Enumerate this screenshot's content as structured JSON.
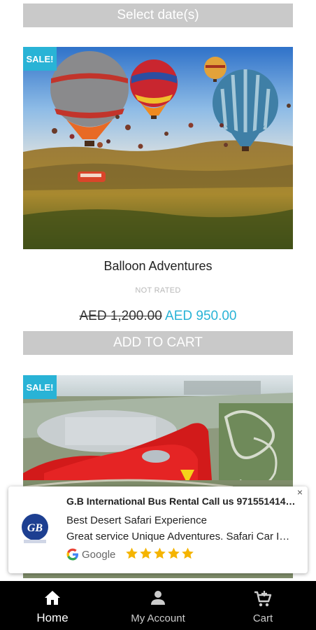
{
  "date_picker": {
    "label": "Select date(s)"
  },
  "products": [
    {
      "badge": "SALE!",
      "title": "Balloon Adventures",
      "rating": "NOT RATED",
      "old_price": "AED 1,200.00",
      "new_price": "AED 950.00",
      "cart_label": "ADD TO CART"
    },
    {
      "badge": "SALE!"
    }
  ],
  "ad": {
    "title": "G.B International Bus Rental Call us 971551414…",
    "line1": "Best Desert Safari Experience",
    "line2": "Great service Unique Adventures. Safari Car I…",
    "source": "Google",
    "rating": 5,
    "close": "×"
  },
  "nav": {
    "home": "Home",
    "account": "My Account",
    "cart": "Cart"
  },
  "colors": {
    "accent": "#29b3d6",
    "button_gray": "#c9c9c9",
    "nav_bg": "#000000",
    "star": "#f5b400"
  }
}
